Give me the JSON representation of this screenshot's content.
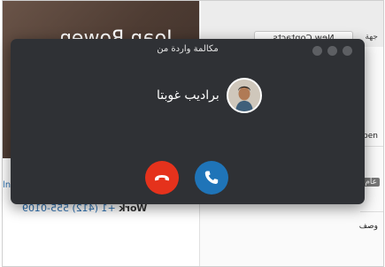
{
  "background_app": {
    "contact_name": "Joan Rowen",
    "phone_type": "Work",
    "phone_number": "+1 (412) 555-0109",
    "tab_label": "New Contacts",
    "tab_label_right": "جهة",
    "detail_chip": "عام",
    "detail_text_1": "pen",
    "detail_text_2": "وصف"
  },
  "call": {
    "title": "مكالمة واردة من",
    "caller_name": "براديب غوبتا",
    "decline_color": "#e5321c",
    "accept_color": "#1f74b8",
    "icons": {
      "decline": "hang-up-icon",
      "accept": "phone-icon"
    }
  }
}
